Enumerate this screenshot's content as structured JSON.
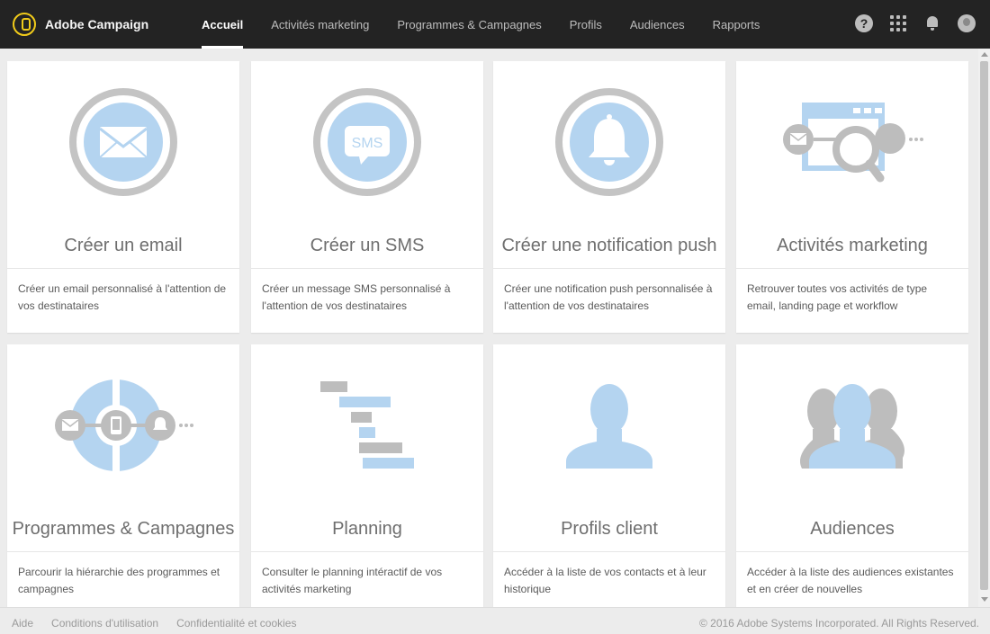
{
  "app": {
    "name": "Adobe Campaign"
  },
  "nav": [
    {
      "label": "Accueil",
      "active": true
    },
    {
      "label": "Activités marketing"
    },
    {
      "label": "Programmes & Campagnes"
    },
    {
      "label": "Profils"
    },
    {
      "label": "Audiences"
    },
    {
      "label": "Rapports"
    }
  ],
  "header_icons": {
    "help": "?"
  },
  "cards": [
    {
      "title": "Créer un email",
      "desc": "Créer un email personnalisé à l'attention de vos destinataires",
      "icon": "email-icon"
    },
    {
      "title": "Créer un SMS",
      "desc": "Créer un message SMS personnalisé à l'attention de vos destinataires",
      "icon": "sms-icon",
      "icon_text": "SMS"
    },
    {
      "title": "Créer une notification push",
      "desc": "Créer une notification push personnalisée à l'attention de vos destinataires",
      "icon": "bell-icon"
    },
    {
      "title": "Activités marketing",
      "desc": "Retrouver toutes vos activités de type email, landing page et workflow",
      "icon": "search-activities-icon"
    },
    {
      "title": "Programmes & Campagnes",
      "desc": "Parcourir la hiérarchie des programmes et campagnes",
      "icon": "programs-icon"
    },
    {
      "title": "Planning",
      "desc": "Consulter le planning intéractif de vos activités marketing",
      "icon": "gantt-icon"
    },
    {
      "title": "Profils client",
      "desc": "Accéder à la liste de vos contacts et à leur historique",
      "icon": "profile-icon"
    },
    {
      "title": "Audiences",
      "desc": "Accéder à la liste des audiences existantes et en créer de nouvelles",
      "icon": "audiences-icon"
    }
  ],
  "footer": {
    "links": [
      "Aide",
      "Conditions d'utilisation",
      "Confidentialité et cookies"
    ],
    "copyright": "© 2016 Adobe Systems Incorporated. All Rights Reserved."
  },
  "colors": {
    "topbar": "#232323",
    "icon_blue": "#b4d4f0",
    "icon_gray": "#bdbdbd",
    "brand_yellow": "#f1cb1a"
  }
}
